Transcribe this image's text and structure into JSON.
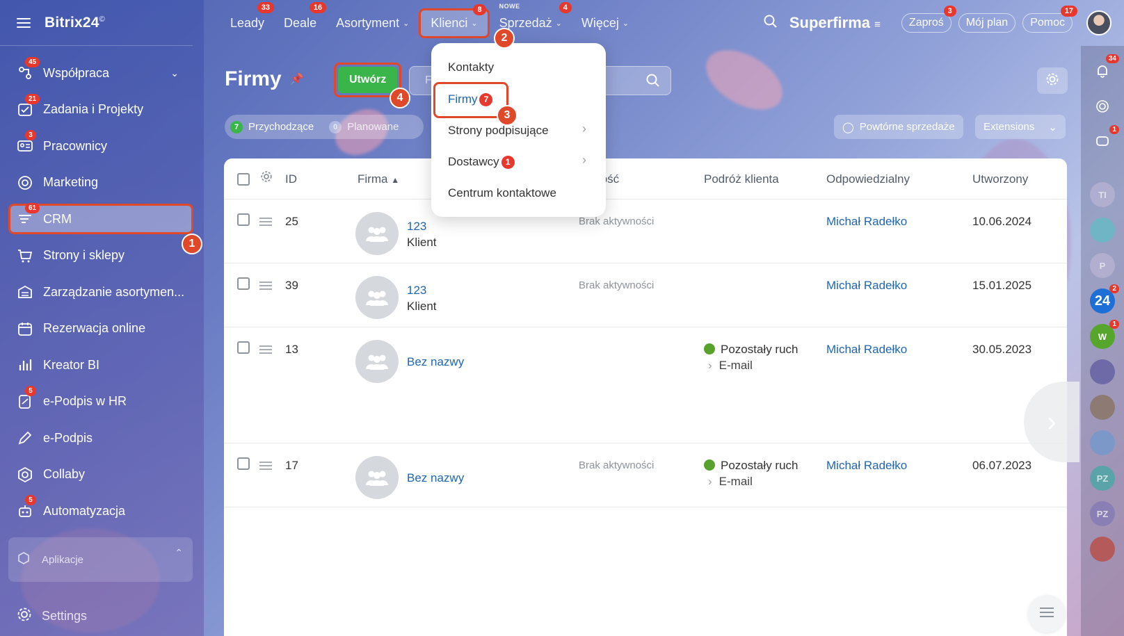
{
  "app": {
    "logo_text": "Bitrix24",
    "logo_sup": "©"
  },
  "sidebar": {
    "items": [
      {
        "label": "Współpraca",
        "badge": "45",
        "icon": "collab-icon",
        "chevron": "⌄"
      },
      {
        "label": "Zadania i Projekty",
        "badge": "21",
        "icon": "tasks-icon"
      },
      {
        "label": "Pracownicy",
        "badge": "3",
        "icon": "employees-icon"
      },
      {
        "label": "Marketing",
        "badge": "",
        "icon": "marketing-icon"
      },
      {
        "label": "CRM",
        "badge": "61",
        "icon": "crm-icon"
      },
      {
        "label": "Strony i sklepy",
        "badge": "",
        "icon": "cart-icon"
      },
      {
        "label": "Zarządzanie asortymen...",
        "badge": "",
        "icon": "inventory-icon"
      },
      {
        "label": "Rezerwacja online",
        "badge": "",
        "icon": "calendar-icon"
      },
      {
        "label": "Kreator BI",
        "badge": "",
        "icon": "bi-chart-icon"
      },
      {
        "label": "e-Podpis w HR",
        "badge": "5",
        "icon": "hr-sign-icon"
      },
      {
        "label": "e-Podpis",
        "badge": "",
        "icon": "pen-icon"
      },
      {
        "label": "Collaby",
        "badge": "",
        "icon": "hexagon-icon"
      },
      {
        "label": "Automatyzacja",
        "badge": "5",
        "icon": "robot-icon"
      }
    ],
    "apps_label": "Aplikacje",
    "settings_label": "Settings"
  },
  "topnav": {
    "items": [
      {
        "label": "Leady",
        "badge": "33"
      },
      {
        "label": "Deale",
        "badge": "16"
      },
      {
        "label": "Asortyment",
        "badge": "",
        "caret": true
      },
      {
        "label": "Klienci",
        "badge": "8",
        "caret": true
      },
      {
        "label": "Sprzedaż",
        "badge": "4",
        "caret": true,
        "new": "NOWE"
      },
      {
        "label": "Więcej",
        "badge": "",
        "caret": true
      }
    ],
    "company": "Superfirma",
    "invite": "Zaproś",
    "invite_badge": "3",
    "plan": "Mój plan",
    "help": "Pomoc",
    "help_badge": "17"
  },
  "dropdown": {
    "items": [
      {
        "label": "Kontakty"
      },
      {
        "label": "Firmy",
        "badge": "7"
      },
      {
        "label": "Strony podpisujące",
        "arrow": "›"
      },
      {
        "label": "Dostawcy",
        "badge": "1",
        "arrow": "›"
      },
      {
        "label": "Centrum kontaktowe"
      }
    ]
  },
  "page": {
    "title": "Firmy",
    "create_label": "Utwórz",
    "search_placeholder": "F",
    "counters": [
      {
        "num": "7",
        "label": "Przychodzące"
      },
      {
        "num": "0",
        "label": "Planowane"
      }
    ],
    "repeat_sales": "Powtórne sprzedaże",
    "extensions": "Extensions"
  },
  "table": {
    "headers": {
      "id": "ID",
      "firma": "Firma",
      "aktywnosc": "wność",
      "podroz": "Podróż klienta",
      "odpowiedzialny": "Odpowiedzialny",
      "utworzony": "Utworzony"
    },
    "rows": [
      {
        "id": "25",
        "name": "123",
        "type": "Klient",
        "activity": "Brak aktywności",
        "journey": "",
        "journey_sub": "",
        "owner": "Michał Radełko",
        "created": "10.06.2024"
      },
      {
        "id": "39",
        "name": "123",
        "type": "Klient",
        "activity": "Brak aktywności",
        "journey": "",
        "journey_sub": "",
        "owner": "Michał Radełko",
        "created": "15.01.2025"
      },
      {
        "id": "13",
        "name": "Bez nazwy",
        "type": "",
        "activity": "",
        "journey": "Pozostały ruch",
        "journey_sub": "E-mail",
        "owner": "Michał Radełko",
        "created": "30.05.2023"
      },
      {
        "id": "17",
        "name": "Bez nazwy",
        "type": "",
        "activity": "Brak aktywności",
        "journey": "Pozostały ruch",
        "journey_sub": "E-mail",
        "owner": "Michał Radełko",
        "created": "06.07.2023"
      }
    ]
  },
  "rail": {
    "notifications_badge": "34",
    "chat_badge": "1",
    "b24_label": "24",
    "b24_badge": "2",
    "w_label": "W",
    "w_badge": "1",
    "t_label": "TI",
    "p_label": "P",
    "pz1_label": "PZ",
    "pz2_label": "PZ"
  },
  "markers": [
    "1",
    "2",
    "3",
    "4"
  ]
}
